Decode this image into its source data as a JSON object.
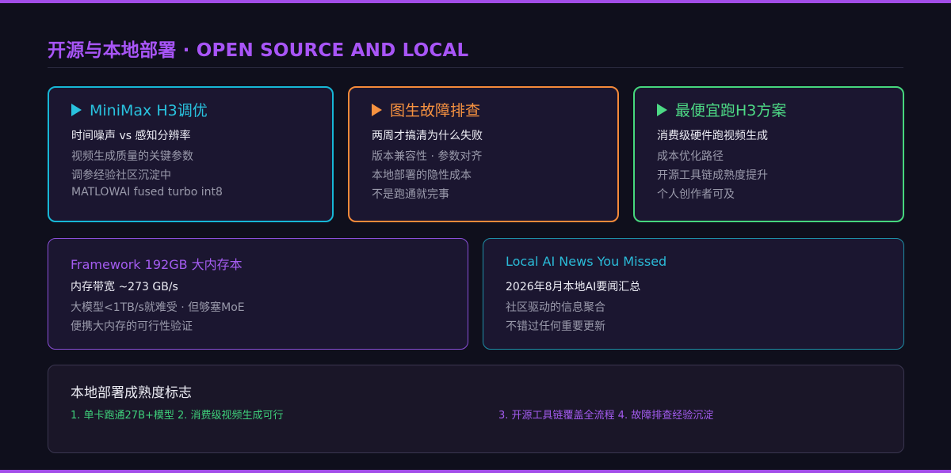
{
  "title": "开源与本地部署 · OPEN SOURCE AND LOCAL",
  "colors": {
    "accent_purple": "#a855f7",
    "cyan": "#17b7d6",
    "orange": "#f58a3a",
    "green": "#46d77d",
    "background": "#0f0f1c"
  },
  "cards": [
    {
      "icon": "play-triangle-icon",
      "title": "MiniMax H3调优",
      "subtitle": "时间噪声 vs 感知分辨率",
      "lines": [
        "视频生成质量的关键参数",
        "调参经验社区沉淀中",
        "MATLOWAI fused turbo int8"
      ]
    },
    {
      "icon": "play-triangle-icon",
      "title": "图生故障排查",
      "subtitle": "两周才搞清为什么失败",
      "lines": [
        "版本兼容性 · 参数对齐",
        "本地部署的隐性成本",
        "不是跑通就完事"
      ]
    },
    {
      "icon": "play-triangle-icon",
      "title": "最便宜跑H3方案",
      "subtitle": "消费级硬件跑视频生成",
      "lines": [
        "成本优化路径",
        "开源工具链成熟度提升",
        "个人创作者可及"
      ]
    },
    {
      "title": "Framework 192GB 大内存本",
      "subtitle": "内存带宽 ~273 GB/s",
      "lines": [
        "大模型<1TB/s就难受 · 但够塞MoE",
        "便携大内存的可行性验证"
      ]
    },
    {
      "title": "Local AI News You Missed",
      "subtitle": "2026年8月本地AI要闻汇总",
      "lines": [
        "社区驱动的信息聚合",
        "不错过任何重要更新"
      ]
    }
  ],
  "maturity": {
    "title": "本地部署成熟度标志",
    "left": "1. 单卡跑通27B+模型 2. 消费级视频生成可行",
    "right": "3. 开源工具链覆盖全流程 4. 故障排查经验沉淀"
  }
}
